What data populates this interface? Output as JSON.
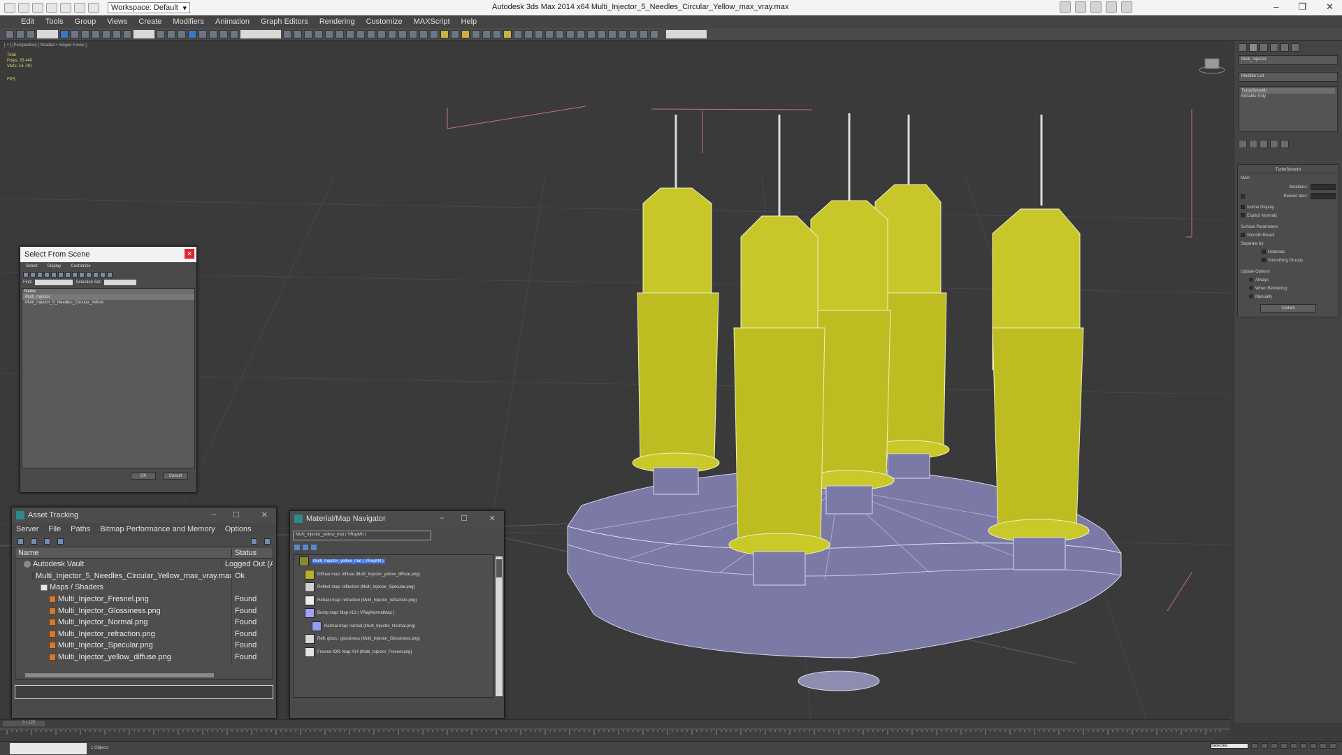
{
  "app": {
    "title": "Autodesk 3ds Max  2014 x64     Multi_Injector_5_Needles_Circular_Yellow_max_vray.max",
    "workspace": "Workspace: Default"
  },
  "menu": [
    "Edit",
    "Tools",
    "Group",
    "Views",
    "Create",
    "Modifiers",
    "Animation",
    "Graph Editors",
    "Rendering",
    "Customize",
    "MAXScript",
    "Help"
  ],
  "toolbar": {
    "selection_filter": "All",
    "ref_coord": "View"
  },
  "viewport": {
    "label": "[ + ] [Perspective] [ Shaded + Edged Faces ]",
    "stats_total": "Total",
    "stats_polys": "Polys:  33 440",
    "stats_verts": "Verts:  16 740",
    "fps": "FPS:"
  },
  "select_from_scene": {
    "title": "Select From Scene",
    "menu": [
      "Select",
      "Display",
      "Customize"
    ],
    "find_label": "Find:",
    "selection_set": "Selection Set:",
    "column": "Name",
    "items": [
      "Multi_Injector",
      "Multi_Injector_5_Needles_Circular_Yellow"
    ],
    "ok": "OK",
    "cancel": "Cancel"
  },
  "asset_tracking": {
    "title": "Asset Tracking",
    "menu": [
      "Server",
      "File",
      "Paths",
      "Bitmap Performance and Memory",
      "Options"
    ],
    "col_name": "Name",
    "col_status": "Status",
    "rows": [
      {
        "name": "Autodesk Vault",
        "status": "Logged Out (A",
        "icon": "vault-icon",
        "indent": 1
      },
      {
        "name": "Multi_Injector_5_Needles_Circular_Yellow_max_vray.max",
        "status": "Ok",
        "icon": "max-file-icon",
        "indent": 2
      },
      {
        "name": "Maps / Shaders",
        "status": "",
        "icon": "folder-icon",
        "indent": 3
      },
      {
        "name": "Multi_Injector_Fresnel.png",
        "status": "Found",
        "icon": "image-file-icon",
        "indent": 4
      },
      {
        "name": "Multi_Injector_Glossiness.png",
        "status": "Found",
        "icon": "image-file-icon",
        "indent": 4
      },
      {
        "name": "Multi_Injector_Normal.png",
        "status": "Found",
        "icon": "image-file-icon",
        "indent": 4
      },
      {
        "name": "Multi_Injector_refraction.png",
        "status": "Found",
        "icon": "image-file-icon",
        "indent": 4
      },
      {
        "name": "Multi_Injector_Specular.png",
        "status": "Found",
        "icon": "image-file-icon",
        "indent": 4
      },
      {
        "name": "Multi_Injector_yellow_diffuse.png",
        "status": "Found",
        "icon": "image-file-icon",
        "indent": 4
      }
    ]
  },
  "material_navigator": {
    "title": "Material/Map Navigator",
    "field": "Multi_Injector_yellow_mat  ( VRayMtl )",
    "items": [
      {
        "text": "Multi_Injector_yellow_mat  ( VRayMtl )",
        "swatch": "#8a8a2a"
      },
      {
        "text": "Diffuse map: diffuse (Multi_Injector_yellow_diffuse.png)",
        "swatch": "#b8b02a"
      },
      {
        "text": "Reflect map: reflection (Multi_Injector_Specular.png)",
        "swatch": "#cfcfcf"
      },
      {
        "text": "Refract map: refraction (Multi_Injector_refraction.png)",
        "swatch": "#eeeeee"
      },
      {
        "text": "Bump map: Map #13  ( VRayNormalMap )",
        "swatch": "#a0a0ff"
      },
      {
        "text": "Normal map: normal (Multi_Injector_Normal.png)",
        "swatch": "#9a9af0"
      },
      {
        "text": "Refl. gloss.: glossiness (Multi_Injector_Glossiness.png)",
        "swatch": "#d8d8d8"
      },
      {
        "text": "Fresnel IOR: Map #14 (Multi_Injector_Fresnel.png)",
        "swatch": "#e4e4e4"
      }
    ]
  },
  "command_panel": {
    "object_name": "Multi_Injector",
    "modifier_list": "Modifier List",
    "stack": [
      "TurboSmooth",
      "Editable Poly"
    ],
    "rollout_title": "TurboSmooth",
    "main": "Main",
    "iterations": "Iterations:",
    "render_iters": "Render Iters:",
    "isoline": "Isoline Display",
    "explicit": "Explicit Normals",
    "surface": "Surface Parameters",
    "smooth_result": "Smooth Result",
    "separate": "Separate by:",
    "materials": "Materials",
    "smoothing_groups": "Smoothing Groups",
    "update_options": "Update Options",
    "always": "Always",
    "when_rendering": "When Rendering",
    "manually": "Manually",
    "update": "Update"
  },
  "timeline": {
    "frame": "0 / 225"
  },
  "status": {
    "text": "1 Objects",
    "selected": "Selected"
  }
}
